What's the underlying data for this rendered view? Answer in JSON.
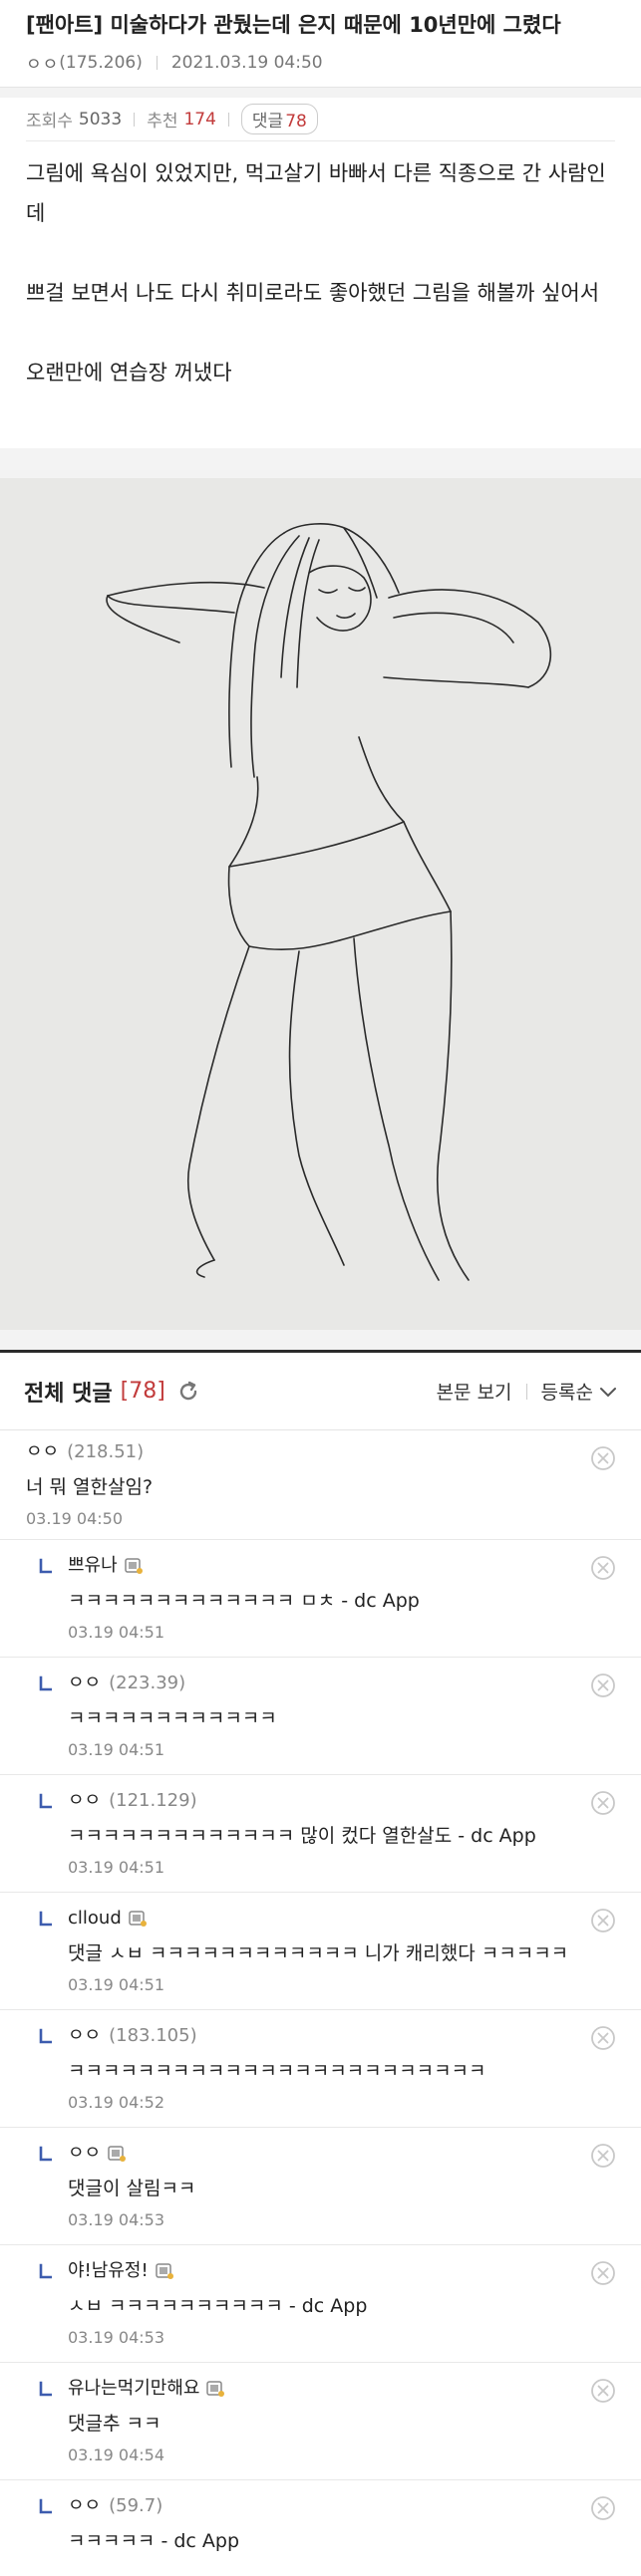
{
  "post": {
    "title": "[팬아트] 미술하다가 관뒀는데 은지 때문에 10년만에 그렸다",
    "author": "ㅇㅇ",
    "author_ip": "(175.206)",
    "datetime": "2021.03.19 04:50",
    "views_label": "조회수",
    "views": "5033",
    "recommend_label": "추천",
    "recommend": "174",
    "comments_label": "댓글",
    "comments": "78",
    "paragraphs": [
      "그림에 욕심이 있었지만, 먹고살기 바빠서 다른 직종으로 간 사람인데",
      "쁘걸 보면서 나도 다시 취미로라도 좋아했던 그림을 해볼까 싶어서",
      "오랜만에 연습장 꺼냈다"
    ],
    "image_desc_icon": "sketch-drawing"
  },
  "comments_header": {
    "title": "전체 댓글",
    "count": "[78]",
    "view_post": "본문 보기",
    "sort": "등록순"
  },
  "comments": [
    {
      "nick": "ㅇㅇ",
      "ip": "(218.51)",
      "body": "너 뭐 열한살임?",
      "date": "03.19 04:50",
      "reply": false,
      "icon": false
    },
    {
      "nick": "쁘유나",
      "ip": "",
      "body": "ㅋㅋㅋㅋㅋㅋㅋㅋㅋㅋㅋㅋㅋ ㅁㅊ - dc App",
      "date": "03.19 04:51",
      "reply": true,
      "icon": true
    },
    {
      "nick": "ㅇㅇ",
      "ip": "(223.39)",
      "body": "ㅋㅋㅋㅋㅋㅋㅋㅋㅋㅋㅋㅋ",
      "date": "03.19 04:51",
      "reply": true,
      "icon": false
    },
    {
      "nick": "ㅇㅇ",
      "ip": "(121.129)",
      "body": "ㅋㅋㅋㅋㅋㅋㅋㅋㅋㅋㅋㅋㅋ 많이 컸다 열한살도 - dc App",
      "date": "03.19 04:51",
      "reply": true,
      "icon": false
    },
    {
      "nick": "clloud",
      "ip": "",
      "body": "댓글 ㅅㅂ ㅋㅋㅋㅋㅋㅋㅋㅋㅋㅋㅋㅋ 니가 캐리했다 ㅋㅋㅋㅋㅋ",
      "date": "03.19 04:51",
      "reply": true,
      "icon": true
    },
    {
      "nick": "ㅇㅇ",
      "ip": "(183.105)",
      "body": "ㅋㅋㅋㅋㅋㅋㅋㅋㅋㅋㅋㅋㅋㅋㅋㅋㅋㅋㅋㅋㅋㅋㅋㅋ",
      "date": "03.19 04:52",
      "reply": true,
      "icon": false
    },
    {
      "nick": "ㅇㅇ",
      "ip": "",
      "body": "댓글이 살림ㅋㅋ",
      "date": "03.19 04:53",
      "reply": true,
      "icon": true
    },
    {
      "nick": "야!남유정!",
      "ip": "",
      "body": "ㅅㅂ ㅋㅋㅋㅋㅋㅋㅋㅋㅋㅋ - dc App",
      "date": "03.19 04:53",
      "reply": true,
      "icon": true
    },
    {
      "nick": "유나는먹기만해요",
      "ip": "",
      "body": "댓글추 ㅋㅋ",
      "date": "03.19 04:54",
      "reply": true,
      "icon": true
    },
    {
      "nick": "ㅇㅇ",
      "ip": "(59.7)",
      "body": "ㅋㅋㅋㅋㅋ - dc App",
      "date": "",
      "reply": true,
      "icon": false
    }
  ],
  "colors": {
    "accent_red": "#c23b3b",
    "meta_gray": "#888888",
    "bg": "#f3f3f3"
  }
}
